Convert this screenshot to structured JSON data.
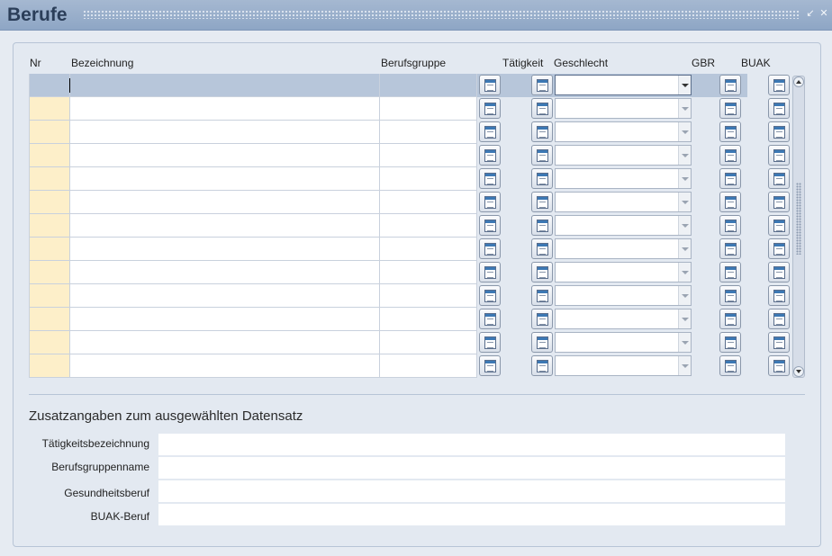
{
  "window": {
    "title": "Berufe"
  },
  "table": {
    "headers": {
      "nr": "Nr",
      "bezeichnung": "Bezeichnung",
      "berufsgruppe": "Berufsgruppe",
      "taetigkeit": "Tätigkeit",
      "geschlecht": "Geschlecht",
      "gbr": "GBR",
      "buak": "BUAK"
    },
    "row_count": 13,
    "selected_row": 1,
    "rows": [
      {
        "nr": "",
        "bezeichnung": "",
        "berufsgruppe": "",
        "geschlecht": ""
      },
      {
        "nr": "",
        "bezeichnung": "",
        "berufsgruppe": "",
        "geschlecht": ""
      },
      {
        "nr": "",
        "bezeichnung": "",
        "berufsgruppe": "",
        "geschlecht": ""
      },
      {
        "nr": "",
        "bezeichnung": "",
        "berufsgruppe": "",
        "geschlecht": ""
      },
      {
        "nr": "",
        "bezeichnung": "",
        "berufsgruppe": "",
        "geschlecht": ""
      },
      {
        "nr": "",
        "bezeichnung": "",
        "berufsgruppe": "",
        "geschlecht": ""
      },
      {
        "nr": "",
        "bezeichnung": "",
        "berufsgruppe": "",
        "geschlecht": ""
      },
      {
        "nr": "",
        "bezeichnung": "",
        "berufsgruppe": "",
        "geschlecht": ""
      },
      {
        "nr": "",
        "bezeichnung": "",
        "berufsgruppe": "",
        "geschlecht": ""
      },
      {
        "nr": "",
        "bezeichnung": "",
        "berufsgruppe": "",
        "geschlecht": ""
      },
      {
        "nr": "",
        "bezeichnung": "",
        "berufsgruppe": "",
        "geschlecht": ""
      },
      {
        "nr": "",
        "bezeichnung": "",
        "berufsgruppe": "",
        "geschlecht": ""
      },
      {
        "nr": "",
        "bezeichnung": "",
        "berufsgruppe": "",
        "geschlecht": ""
      }
    ]
  },
  "details": {
    "title": "Zusatzangaben zum ausgewählten Datensatz",
    "fields": [
      {
        "label": "Tätigkeitsbezeichnung",
        "value": ""
      },
      {
        "label": "Berufsgruppenname",
        "value": ""
      },
      {
        "label": "Gesundheitsberuf",
        "value": ""
      },
      {
        "label": "BUAK-Beruf",
        "value": ""
      }
    ]
  },
  "colors": {
    "titlebar": "#8ea6c5",
    "panel": "#e3e9f1",
    "nr_cell": "#fdefc9",
    "selected_row": "#b7c6da"
  },
  "icons": {
    "row_button": "list-form-icon",
    "minimize": "minimize-icon",
    "close": "close-icon"
  }
}
